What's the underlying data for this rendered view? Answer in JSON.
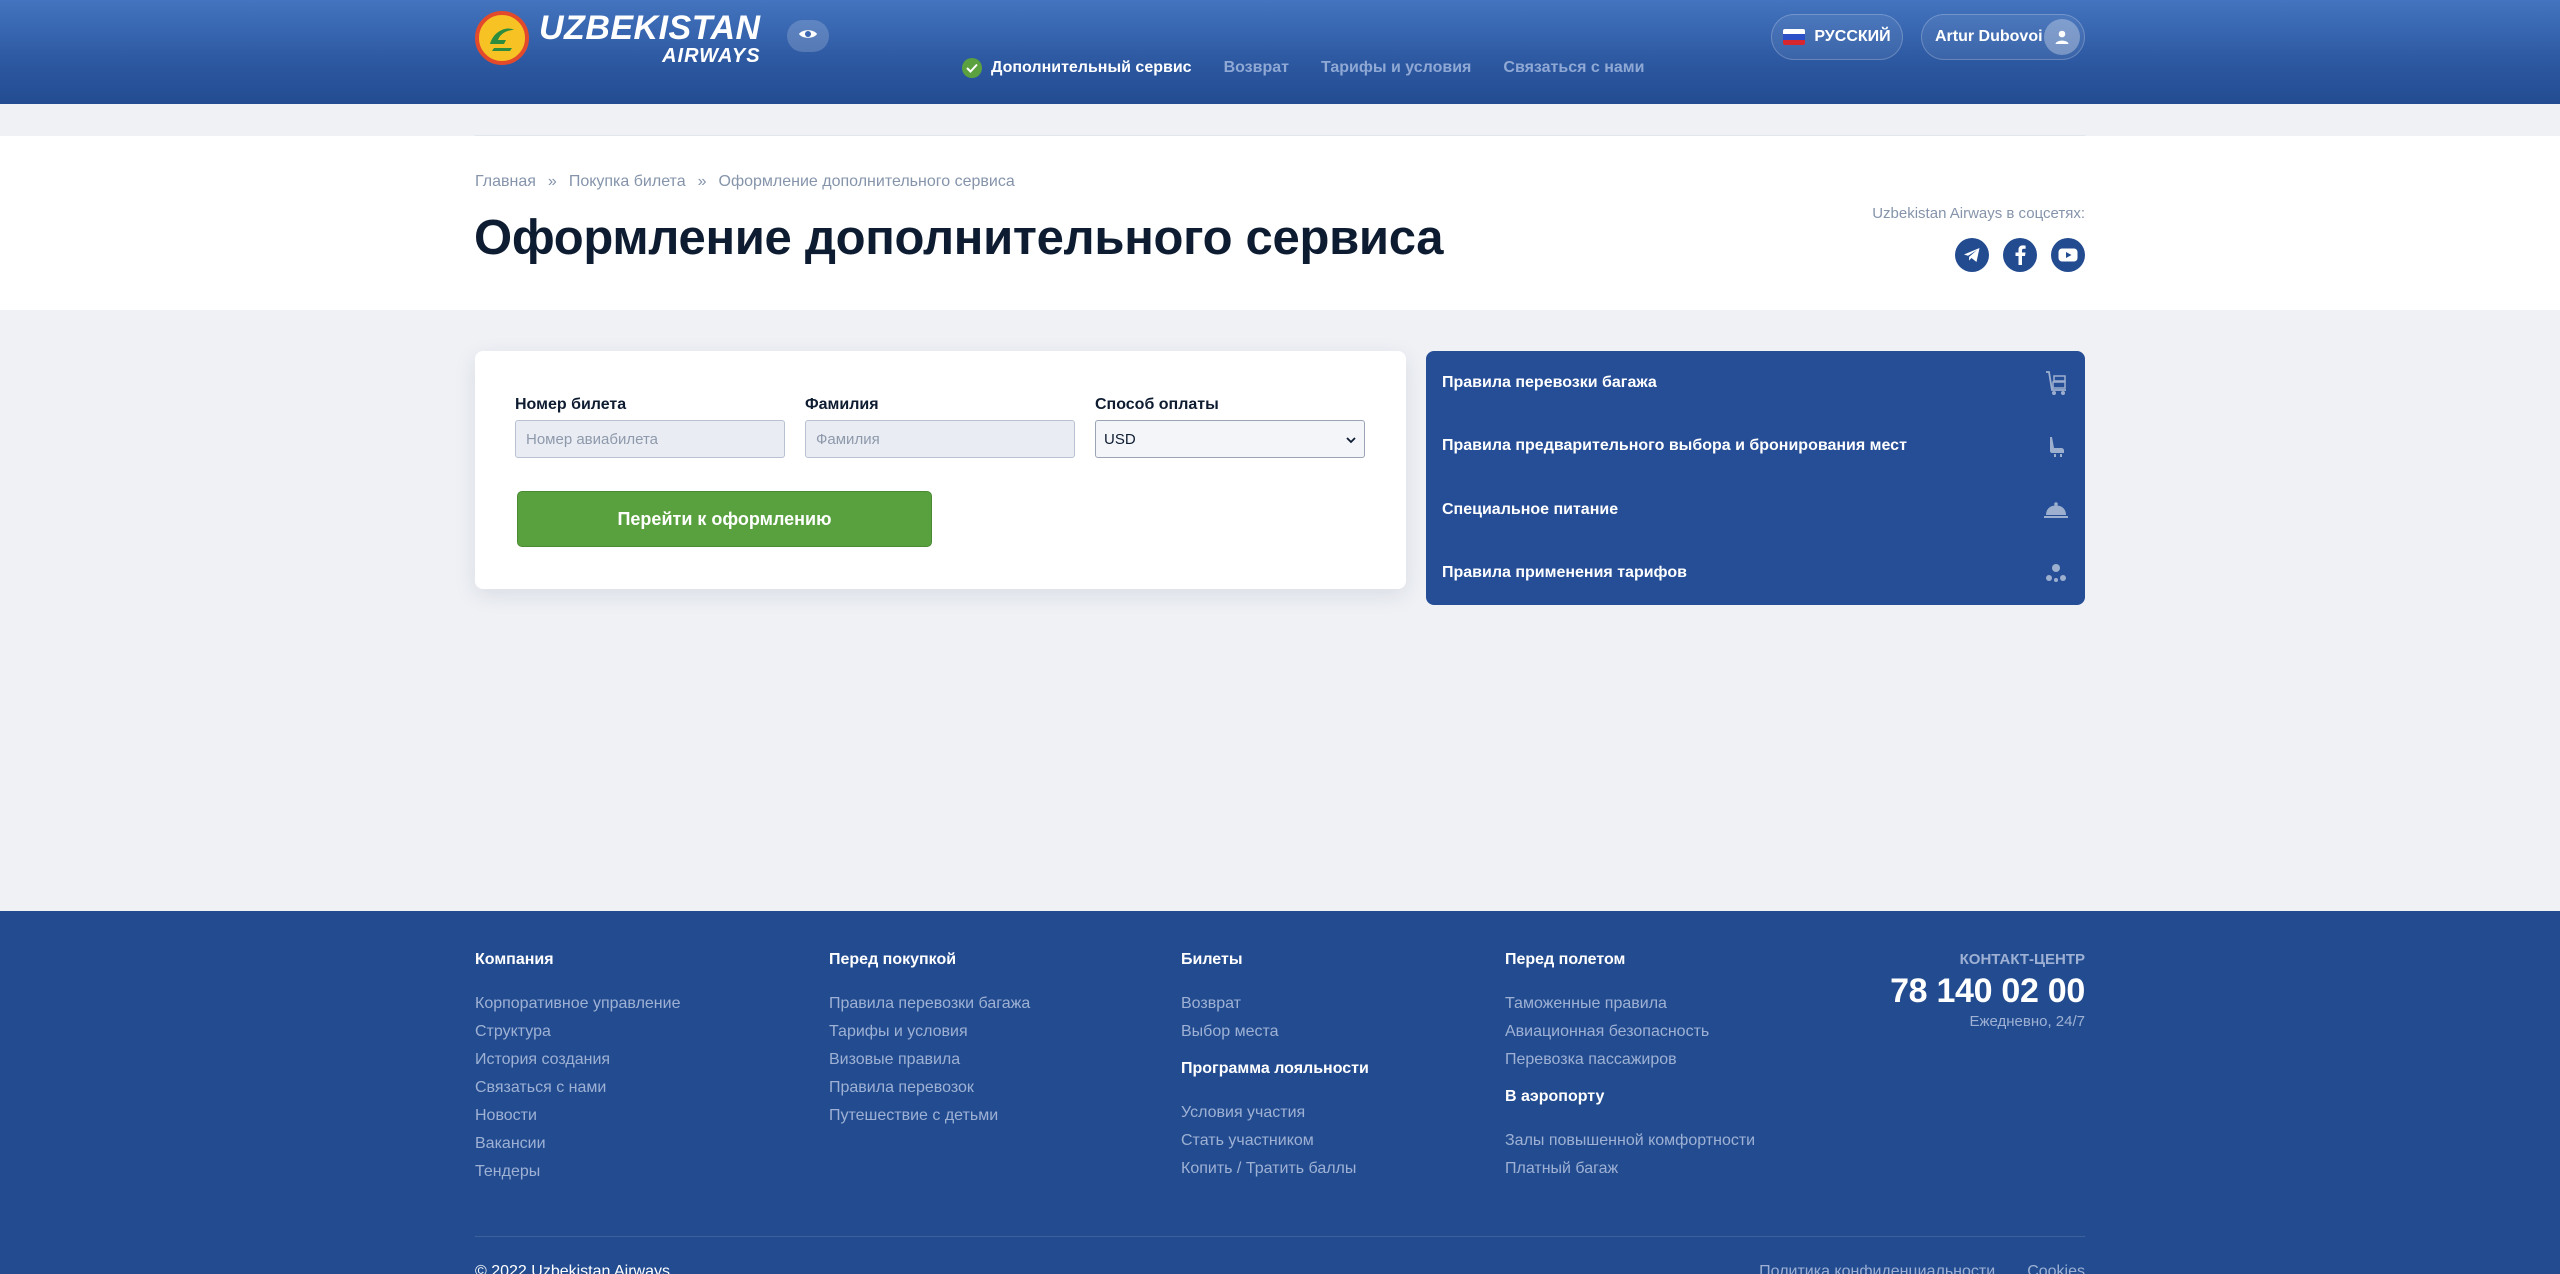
{
  "header": {
    "logo_line1": "UZBEKISTAN",
    "logo_line2": "AIRWAYS",
    "nav": [
      {
        "label": "Дополнительный сервис"
      },
      {
        "label": "Возврат"
      },
      {
        "label": "Тарифы и условия"
      },
      {
        "label": "Связаться с нами"
      }
    ],
    "language": "РУССКИЙ",
    "user_name": "Artur Dubovoi"
  },
  "page": {
    "breadcrumb": [
      "Главная",
      "»",
      "Покупка билета",
      "»",
      "Оформление дополнительного сервиса"
    ],
    "title": "Оформление дополнительного сервиса",
    "social_label": "Uzbekistan Airways в соцсетях:"
  },
  "form": {
    "ticket_label": "Номер билета",
    "ticket_placeholder": "Номер авиабилета",
    "surname_label": "Фамилия",
    "surname_placeholder": "Фамилия",
    "payment_label": "Способ оплаты",
    "payment_value": "USD",
    "submit_label": "Перейти к оформлению"
  },
  "side_panel": [
    {
      "label": "Правила перевозки багажа",
      "icon": "luggage-cart-icon"
    },
    {
      "label": "Правила предварительного выбора и бронирования мест",
      "icon": "seat-icon"
    },
    {
      "label": "Специальное питание",
      "icon": "cloche-icon"
    },
    {
      "label": "Правила применения тарифов",
      "icon": "fare-rules-icon"
    }
  ],
  "footer": {
    "company": {
      "title": "Компания",
      "links": [
        "Корпоративное управление",
        "Структура",
        "История создания",
        "Связаться с нами",
        "Новости",
        "Вакансии",
        "Тендеры"
      ]
    },
    "before_purchase": {
      "title": "Перед покупкой",
      "links": [
        "Правила перевозки багажа",
        "Тарифы и условия",
        "Визовые правила",
        "Правила перевозок",
        "Путешествие с детьми"
      ]
    },
    "tickets": {
      "title": "Билеты",
      "links": [
        "Возврат",
        "Выбор места"
      ],
      "loyalty_title": "Программа лояльности",
      "loyalty_links": [
        "Условия участия",
        "Стать участником",
        "Копить / Тратить баллы"
      ]
    },
    "before_flight": {
      "title": "Перед полетом",
      "links": [
        "Таможенные правила",
        "Авиационная безопасность",
        "Перевозка пассажиров"
      ],
      "airport_title": "В аэропорту",
      "airport_links": [
        "Залы повышенной комфортности",
        "Платный багаж"
      ]
    },
    "contact": {
      "label": "КОНТАКТ-ЦЕНТР",
      "phone": "78 140 02 00",
      "hours": "Ежедневно, 24/7"
    },
    "copyright": "© 2022 Uzbekistan Airways",
    "bottom_links": [
      "Политика конфиденциальности",
      "Cookies"
    ]
  },
  "colors": {
    "header_blue": "#2e5aa3",
    "panel_blue": "#264e96",
    "footer_blue": "#234c90",
    "accent_green": "#59a13e"
  }
}
